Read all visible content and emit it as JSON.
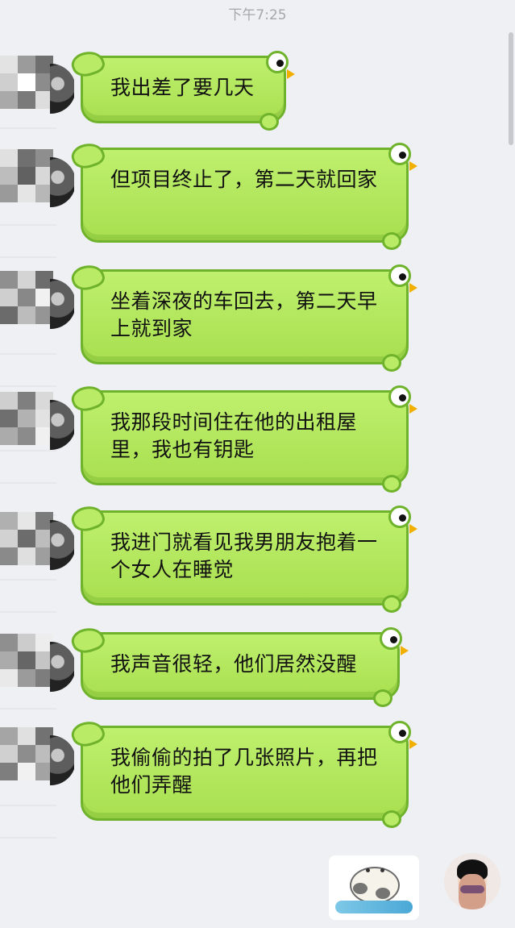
{
  "status": {
    "time": "下午7:25"
  },
  "messages": [
    {
      "text": "我出差了要几天"
    },
    {
      "text": "但项目终止了，第二天就回家"
    },
    {
      "text": "坐着深夜的车回去，第二天早上就到家"
    },
    {
      "text": "我那段时间住在他的出租屋里，我也有钥匙"
    },
    {
      "text": "我进门就看见我男朋友抱着一个女人在睡觉"
    },
    {
      "text": "我声音很轻，他们居然没醒"
    },
    {
      "text": "我偷偷的拍了几张照片，再把他们弄醒"
    }
  ],
  "icons": {
    "sender_avatar": "mosaic-avatar-icon",
    "bubble_style": "bird-bubble-icon",
    "sticker": "sticker-icon",
    "self_avatar": "avatar-icon"
  },
  "colors": {
    "bubble_fill": "#b9eb66",
    "bubble_border": "#6fb22b",
    "page_bg": "#eef0f4"
  }
}
